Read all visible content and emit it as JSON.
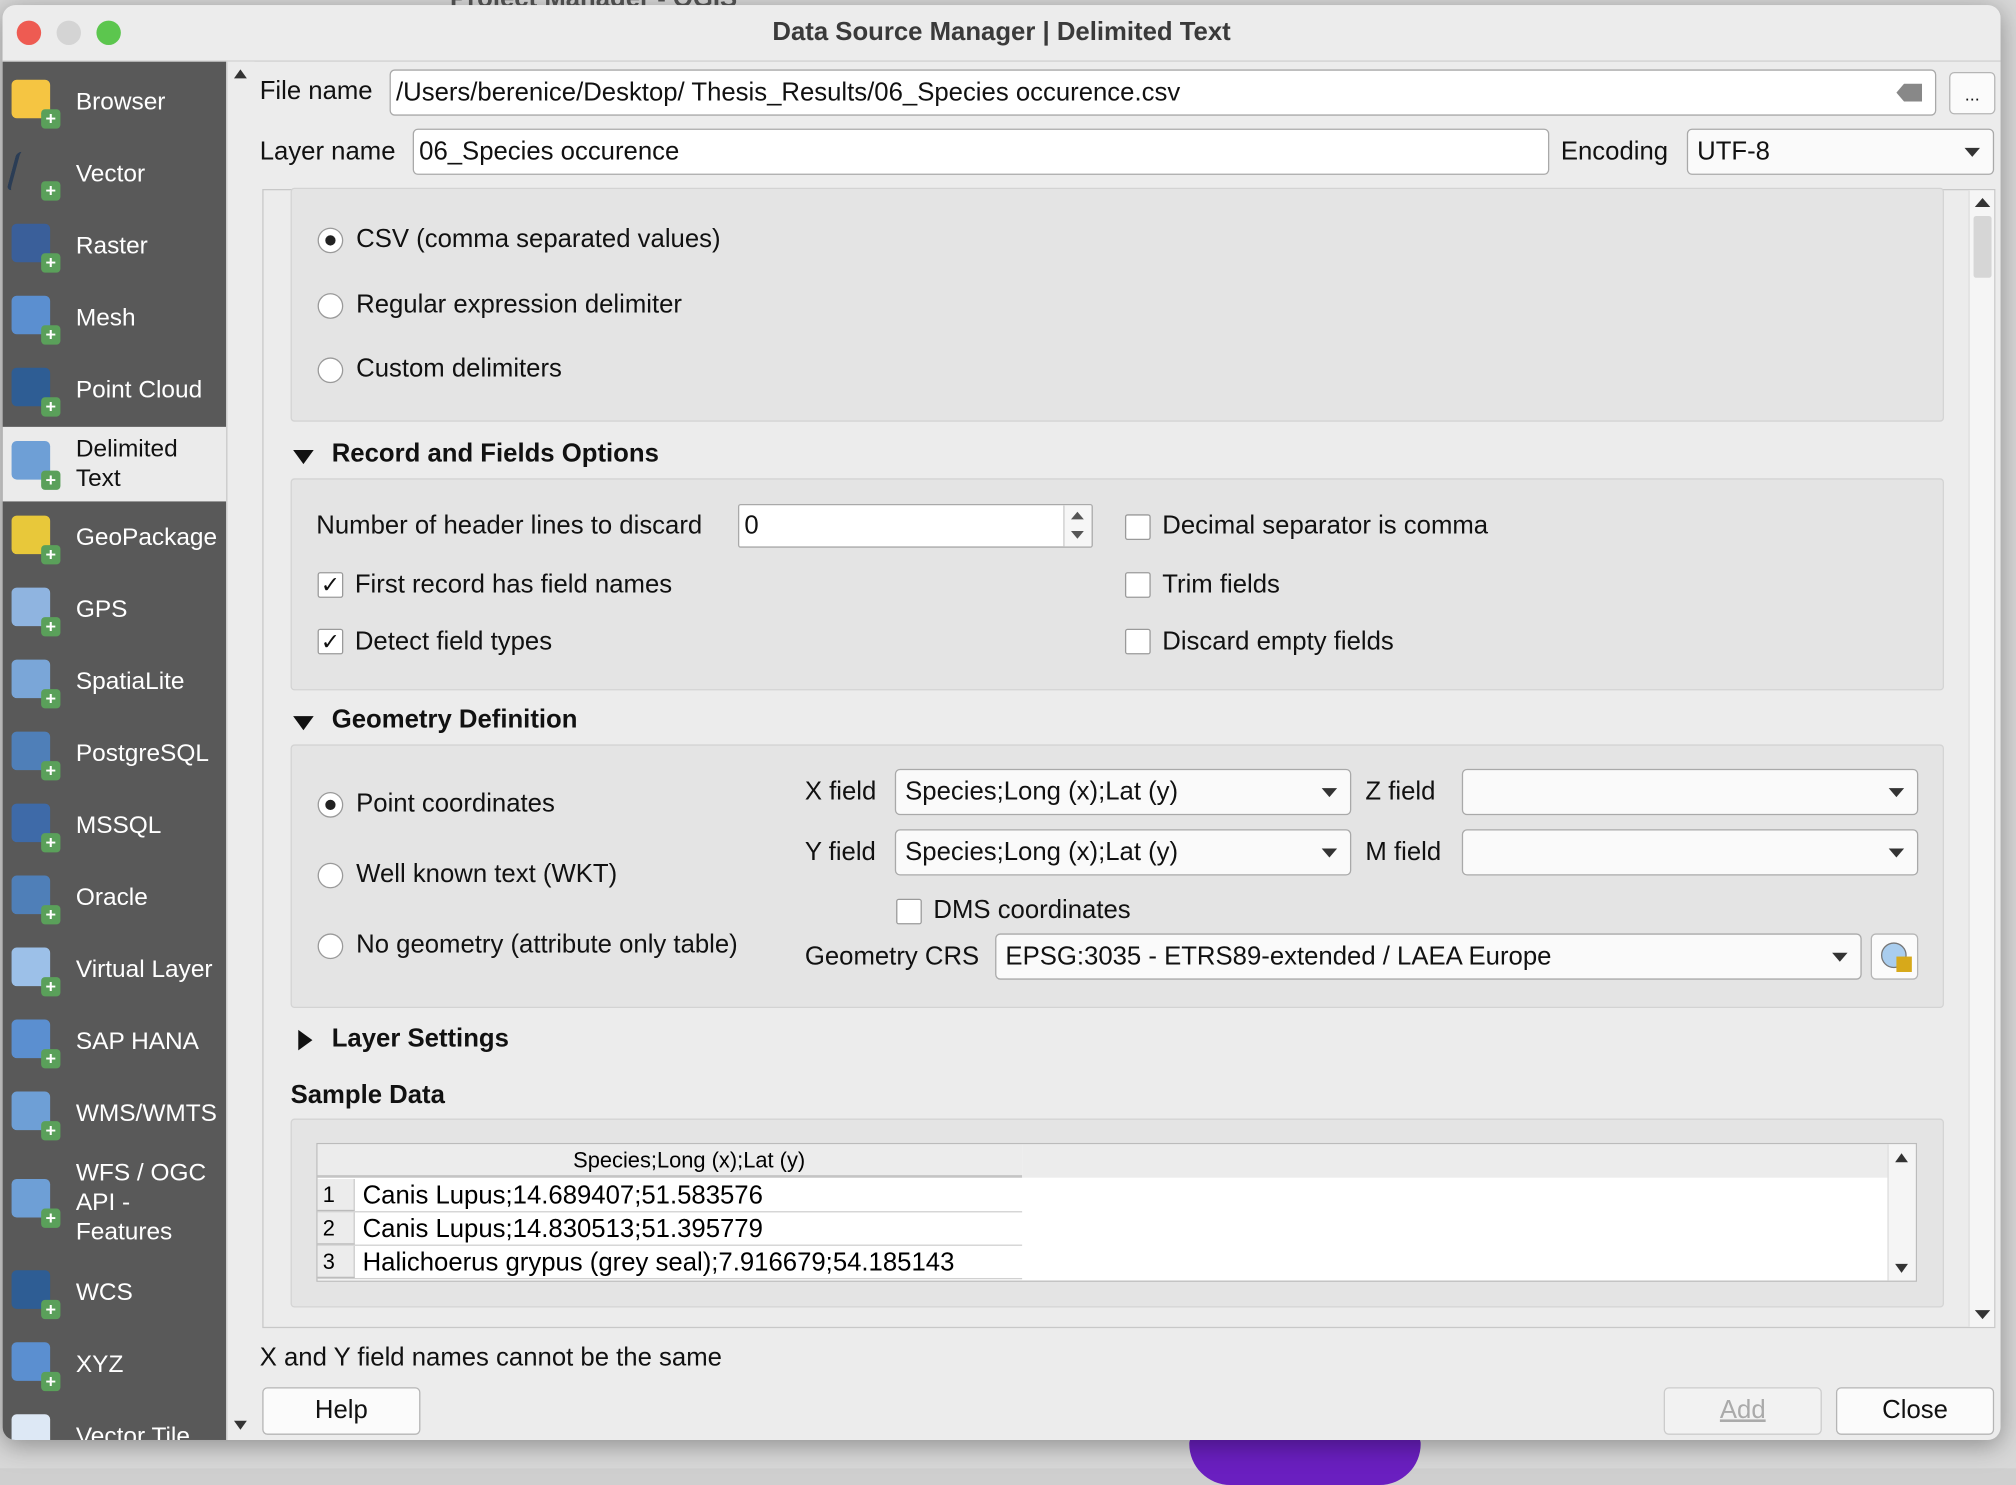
{
  "window": {
    "title": "Data Source Manager | Delimited Text",
    "background_title": "Project Manager - QGIS"
  },
  "sidebar": {
    "items": [
      {
        "label": "Browser",
        "icon": "folder-icon",
        "color": "#f5c542"
      },
      {
        "label": "Vector",
        "icon": "vector-icon",
        "color": "#2b3d55"
      },
      {
        "label": "Raster",
        "icon": "raster-icon",
        "color": "#3a5f9a"
      },
      {
        "label": "Mesh",
        "icon": "mesh-icon",
        "color": "#5b8fd0"
      },
      {
        "label": "Point Cloud",
        "icon": "point-cloud-icon",
        "color": "#2e5d94"
      },
      {
        "label": "Delimited Text",
        "icon": "comma-icon",
        "color": "#6e9fd6",
        "selected": true
      },
      {
        "label": "GeoPackage",
        "icon": "geopackage-icon",
        "color": "#e8c83a"
      },
      {
        "label": "GPS",
        "icon": "gps-icon",
        "color": "#8fb4e0"
      },
      {
        "label": "SpatiaLite",
        "icon": "feather-icon",
        "color": "#7aa6d8"
      },
      {
        "label": "PostgreSQL",
        "icon": "elephant-icon",
        "color": "#4f7fb8"
      },
      {
        "label": "MSSQL",
        "icon": "mssql-icon",
        "color": "#3e6aa8"
      },
      {
        "label": "Oracle",
        "icon": "oracle-icon",
        "color": "#4f7fb8"
      },
      {
        "label": "Virtual Layer",
        "icon": "virtual-layer-icon",
        "color": "#9cc0e8"
      },
      {
        "label": "SAP HANA",
        "icon": "sap-hana-icon",
        "color": "#5b8fd0"
      },
      {
        "label": "WMS/WMTS",
        "icon": "globe-icon",
        "color": "#6e9fd6"
      },
      {
        "label": "WFS / OGC API - Features",
        "icon": "wfs-globe-icon",
        "color": "#6e9fd6"
      },
      {
        "label": "WCS",
        "icon": "wcs-globe-icon",
        "color": "#2e5d94"
      },
      {
        "label": "XYZ",
        "icon": "xyz-grid-icon",
        "color": "#5b8fd0"
      },
      {
        "label": "Vector Tile",
        "icon": "vector-tile-icon",
        "color": "#dde8f5"
      }
    ]
  },
  "file": {
    "label": "File name",
    "value": "/Users/berenice/Desktop/ Thesis_Results/06_Species occurence.csv",
    "browse_label": "..."
  },
  "layer": {
    "label": "Layer name",
    "value": "06_Species occurence",
    "encoding_label": "Encoding",
    "encoding_value": "UTF-8"
  },
  "format": {
    "options": [
      {
        "label": "CSV (comma separated values)",
        "selected": true
      },
      {
        "label": "Regular expression delimiter",
        "selected": false
      },
      {
        "label": "Custom delimiters",
        "selected": false
      }
    ]
  },
  "record_options": {
    "title": "Record and Fields Options",
    "header_lines_label": "Number of header lines to discard",
    "header_lines_value": "0",
    "first_record_label": "First record has field names",
    "first_record_checked": true,
    "detect_types_label": "Detect field types",
    "detect_types_checked": true,
    "decimal_comma_label": "Decimal separator is comma",
    "decimal_comma_checked": false,
    "trim_label": "Trim fields",
    "trim_checked": false,
    "discard_empty_label": "Discard empty fields",
    "discard_empty_checked": false
  },
  "geometry": {
    "title": "Geometry Definition",
    "options": [
      {
        "label": "Point coordinates",
        "selected": true
      },
      {
        "label": "Well known text (WKT)",
        "selected": false
      },
      {
        "label": "No geometry (attribute only table)",
        "selected": false
      }
    ],
    "x_label": "X field",
    "x_value": "Species;Long (x);Lat (y)",
    "y_label": "Y field",
    "y_value": "Species;Long (x);Lat (y)",
    "z_label": "Z field",
    "z_value": "",
    "m_label": "M field",
    "m_value": "",
    "dms_label": "DMS coordinates",
    "dms_checked": false,
    "crs_label": "Geometry CRS",
    "crs_value": "EPSG:3035 - ETRS89-extended / LAEA Europe"
  },
  "layer_settings": {
    "title": "Layer Settings"
  },
  "sample": {
    "title": "Sample Data",
    "column": "Species;Long (x);Lat (y)",
    "rows": [
      {
        "n": "1",
        "value": "Canis Lupus;14.689407;51.583576"
      },
      {
        "n": "2",
        "value": "Canis Lupus;14.830513;51.395779"
      },
      {
        "n": "3",
        "value": "Halichoerus grypus (grey seal);7.916679;54.185143"
      }
    ]
  },
  "status": "X and Y field names cannot be the same",
  "buttons": {
    "help": "Help",
    "add": "Add",
    "close": "Close"
  }
}
